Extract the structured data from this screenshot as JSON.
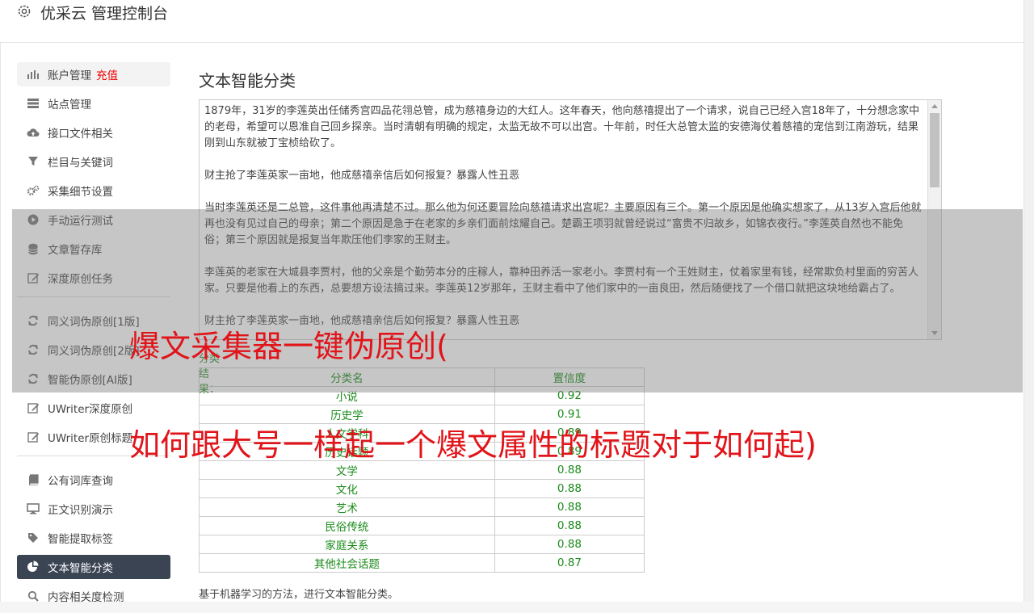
{
  "header": {
    "title": "优采云 管理控制台",
    "icon": "gear-icon"
  },
  "sidebar": {
    "items": [
      {
        "label": "账户管理",
        "badge": "充值",
        "icon": "bar-chart-icon"
      },
      {
        "label": "站点管理",
        "icon": "server-icon"
      },
      {
        "label": "接口文件相关",
        "icon": "cloud-upload-icon"
      },
      {
        "label": "栏目与关键词",
        "icon": "filter-icon"
      },
      {
        "label": "采集细节设置",
        "icon": "gears-icon"
      },
      {
        "label": "手动运行测试",
        "icon": "play-icon"
      },
      {
        "label": "文章暂存库",
        "icon": "database-icon"
      },
      {
        "label": "深度原创任务",
        "icon": "edit-icon"
      },
      {
        "label": "同义词伪原创[1版]",
        "icon": "refresh-icon"
      },
      {
        "label": "同义词伪原创[2版]",
        "icon": "refresh-icon"
      },
      {
        "label": "智能伪原创[AI版]",
        "icon": "refresh-icon"
      },
      {
        "label": "UWriter深度原创",
        "icon": "edit-icon"
      },
      {
        "label": "UWriter原创标题",
        "icon": "edit-icon"
      },
      {
        "label": "公有词库查询",
        "icon": "book-icon"
      },
      {
        "label": "正文识别演示",
        "icon": "monitor-icon"
      },
      {
        "label": "智能提取标签",
        "icon": "tag-icon"
      },
      {
        "label": "文本智能分类",
        "icon": "pie-chart-icon"
      },
      {
        "label": "内容相关度检测",
        "icon": "search-icon"
      }
    ]
  },
  "main": {
    "title": "文本智能分类",
    "text_paragraphs": [
      "1879年，31岁的李莲英出任储秀宫四品花翎总管，成为慈禧身边的大红人。这年春天，他向慈禧提出了一个请求，说自己已经入宫18年了，十分想念家中的老母，希望可以恩准自己回乡探亲。当时清朝有明确的规定，太监无故不可以出宫。十年前，时任大总管太监的安德海仗着慈禧的宠信到江南游玩，结果刚到山东就被丁宝桢给砍了。",
      "财主抢了李莲英家一亩地，他成慈禧亲信后如何报复？暴露人性丑恶",
      "当时李莲英还是二总管，这件事他再清楚不过。那么他为何还要冒险向慈禧请求出宫呢？主要原因有三个。第一个原因是他确实想家了，从13岁入宫后他就再也没有见过自己的母亲；第二个原因是急于在老家的乡亲们面前炫耀自己。楚霸王项羽就曾经说过“富贵不归故乡，如锦衣夜行。”李莲英自然也不能免俗；第三个原因就是报复当年欺压他们李家的王财主。",
      "李莲英的老家在大城县李贾村，他的父亲是个勤劳本分的庄稼人，靠种田养活一家老小。李贾村有一个王姓财主，仗着家里有钱，经常欺负村里面的穷苦人家。只要是他看上的东西，总要想方设法搞过来。李莲英12岁那年，王财主看中了他们家中的一亩良田，然后随便找了一个借口就把这块地给霸占了。",
      "财主抢了李莲英家一亩地，他成慈禧亲信后如何报复？暴露人性丑恶"
    ],
    "result_label": "分类结果：",
    "table": {
      "headers": [
        "分类名",
        "置信度"
      ],
      "rows": [
        [
          "小说",
          "0.92"
        ],
        [
          "历史学",
          "0.91"
        ],
        [
          "人文学科",
          "0.89"
        ],
        [
          "历史话题",
          "0.89"
        ],
        [
          "文学",
          "0.88"
        ],
        [
          "文化",
          "0.88"
        ],
        [
          "艺术",
          "0.88"
        ],
        [
          "民俗传统",
          "0.88"
        ],
        [
          "家庭关系",
          "0.88"
        ],
        [
          "其他社会话题",
          "0.87"
        ]
      ]
    },
    "footnote": "基于机器学习的方法，进行文本智能分类。"
  },
  "overlay": {
    "line1": "爆文采集器一键伪原创(",
    "line2": "如何跟大号一样起一个爆文属性的标题对于如何起)"
  },
  "colors": {
    "active_nav_bg": "#3a4453",
    "badge": "#e00000",
    "result_green": "#1a8a1a",
    "overlay_text": "#e1141a"
  }
}
